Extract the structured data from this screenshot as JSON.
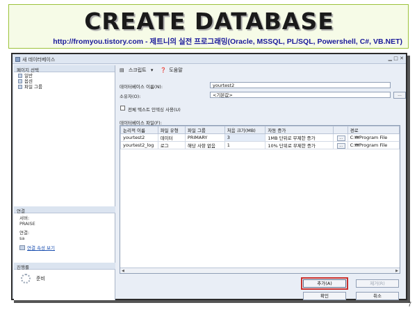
{
  "slide": {
    "title": "CREATE DATABASE",
    "subtitle": "http://fromyou.tistory.com - 제트니의 실전 프로그래밍(Oracle, MSSQL, PL/SQL, Powershell, C#, VB.NET)",
    "page_number": "7"
  },
  "window": {
    "title": "새 데이터베이스"
  },
  "leftpane": {
    "page_select_header": "페이지 선택",
    "pages": [
      "일반",
      "옵션",
      "파일 그룹"
    ],
    "connection_header": "연결",
    "server_label": "서버:",
    "server_value": "PRAISE",
    "connection_label": "연결:",
    "connection_value": "sa",
    "connection_props_link": "연결 속성 보기",
    "progress_header": "진행률",
    "progress_status": "준비"
  },
  "toolbar": {
    "script_label": "스크립트",
    "help_label": "도움말"
  },
  "form": {
    "db_name_label": "데이터베이스 이름(N):",
    "db_name_value": "yourtest2",
    "owner_label": "소유자(O):",
    "owner_value": "<기본값>",
    "browse_label": "...",
    "fulltext_label": "전체 텍스트 인덱싱 사용(U)",
    "files_label": "데이터베이스 파일(F):"
  },
  "grid": {
    "columns": [
      "논리적 이름",
      "파일 유형",
      "파일 그룹",
      "처음 크기(MB)",
      "자동 증가",
      "",
      "경로"
    ],
    "rows": [
      [
        "yourtest2",
        "데이터",
        "PRIMARY",
        "3",
        "1MB 단위로 무제한 증가",
        "...",
        "C:₩Program File"
      ],
      [
        "yourtest2_log",
        "로그",
        "해당 사항 없음",
        "1",
        "10% 단위로 무제한 증가",
        "...",
        "C:₩Program File"
      ]
    ]
  },
  "buttons": {
    "add": "추가(A)",
    "remove": "제거(R)",
    "ok": "확인",
    "cancel": "취소"
  }
}
